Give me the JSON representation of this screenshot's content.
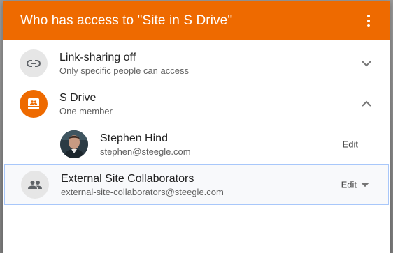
{
  "dialog": {
    "title": "Who has access to \"Site in S Drive\""
  },
  "link_sharing": {
    "title": "Link-sharing off",
    "subtitle": "Only specific people can access",
    "icon": "link-icon"
  },
  "drive": {
    "title": "S Drive",
    "subtitle": "One member",
    "icon": "shared-drive-icon",
    "icon_color": "#ee6a00"
  },
  "members": [
    {
      "name": "Stephen Hind",
      "email": "stephen@steegle.com",
      "role_action": "Edit"
    }
  ],
  "group": {
    "name": "External Site Collaborators",
    "email": "external-site-collaborators@steegle.com",
    "role_action": "Edit",
    "icon": "group-icon"
  },
  "theme": {
    "header_color": "#ee6a00",
    "selected_border": "#a8c7fa"
  }
}
